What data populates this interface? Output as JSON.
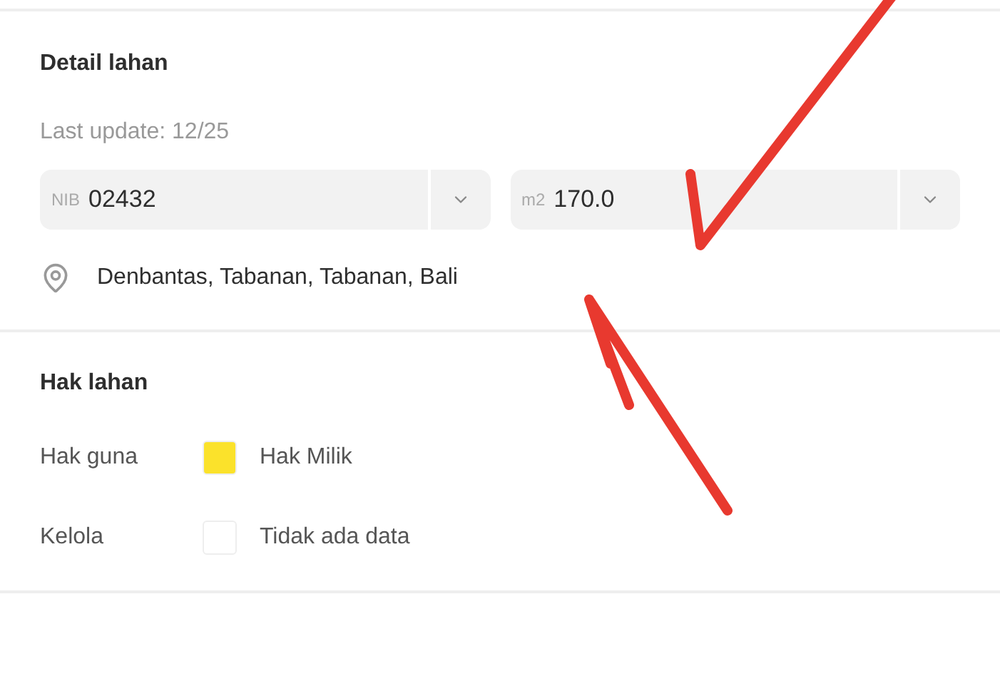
{
  "detail": {
    "title": "Detail lahan",
    "last_update": "Last update: 12/25",
    "fields": [
      {
        "prefix": "NIB",
        "value": "02432"
      },
      {
        "prefix": "m2",
        "value": "170.0"
      }
    ],
    "location": "Denbantas, Tabanan, Tabanan, Bali"
  },
  "rights": {
    "title": "Hak lahan",
    "rows": [
      {
        "label": "Hak guna",
        "value": "Hak Milik",
        "color": "#fbe22b"
      },
      {
        "label": "Kelola",
        "value": "Tidak ada data",
        "color": "#ffffff"
      }
    ]
  }
}
